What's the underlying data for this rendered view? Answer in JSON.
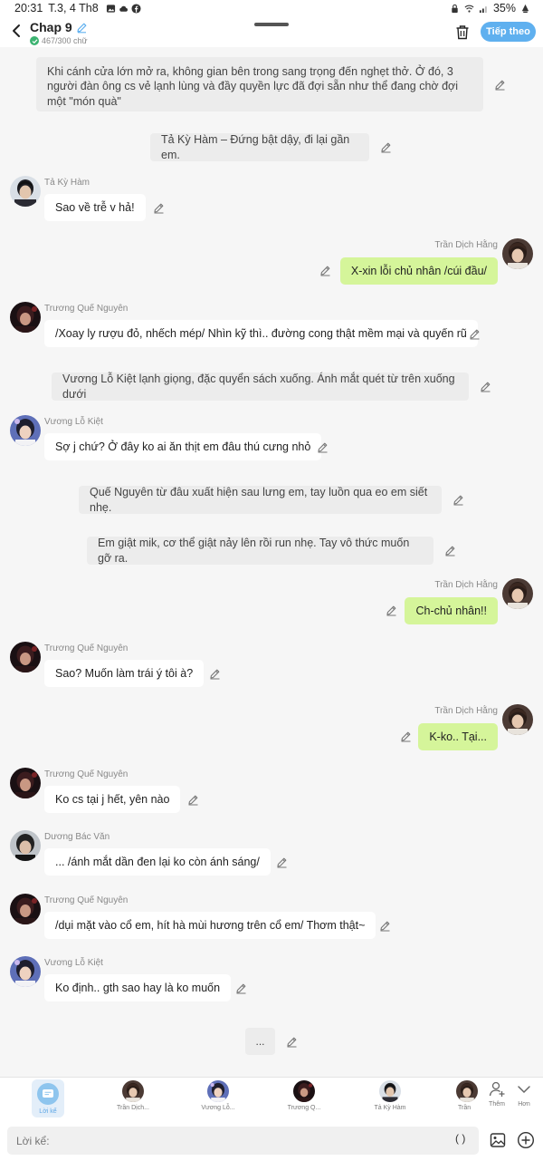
{
  "status_bar": {
    "time": "20:31",
    "date": "T.3, 4 Th8",
    "battery": "35%"
  },
  "header": {
    "title": "Chap 9",
    "word_count": "467/300 chữ",
    "next_label": "Tiếp theo"
  },
  "narrations": [
    "Khi cánh cửa lớn mở ra, không gian bên trong sang trọng đến nghẹt thở. Ở đó, 3 người đàn ông cs vẻ lạnh lùng và đầy quyền lực đã đợi sẵn như thể đang chờ đợi một \"món quà\"",
    "Tả Kỳ Hàm – Đứng bật dậy, đi lại gần em.",
    "Vương Lỗ Kiệt lạnh giọng, đặc quyển sách xuống. Ánh mắt quét từ trên xuống dưới",
    "Quế Nguyên từ đâu xuất hiện sau lưng em, tay luồn qua eo em siết nhẹ.",
    "Em giật mik, cơ thể giật nảy lên rồi run nhẹ. Tay vô thức muốn gỡ ra."
  ],
  "messages": [
    {
      "sender": "Tả Kỳ Hàm",
      "text": "Sao về trễ v hả!"
    },
    {
      "sender": "Trần Dịch Hằng",
      "text": "X-xin lỗi chủ nhân /cúi đầu/"
    },
    {
      "sender": "Trương Quế Nguyên",
      "text": "/Xoay ly rượu đỏ, nhếch mép/ Nhìn kỹ thì.. đường cong thật mềm mại và quyến rũ"
    },
    {
      "sender": "Vương Lỗ Kiệt",
      "text": "Sợ j chứ? Ở đây ko ai ăn thịt em đâu thú cưng nhỏ"
    },
    {
      "sender": "Trần Dịch Hằng",
      "text": "Ch-chủ nhân!!"
    },
    {
      "sender": "Trương Quế Nguyên",
      "text": "Sao? Muốn làm trái ý tôi à?"
    },
    {
      "sender": "Trần Dịch Hằng",
      "text": "K-ko.. Tại..."
    },
    {
      "sender": "Trương Quế Nguyên",
      "text": "Ko cs tại j hết, yên nào"
    },
    {
      "sender": "Dương Bác Văn",
      "text": "... /ánh mắt dần đen lại ko còn ánh sáng/"
    },
    {
      "sender": "Trương Quế Nguyên",
      "text": "/dụi mặt vào cổ em, hít hà mùi hương trên cổ em/ Thơm thật~"
    },
    {
      "sender": "Vương Lỗ Kiệt",
      "text": "Ko định.. gth sao hay là ko muốn"
    }
  ],
  "pending": "...",
  "character_bar": {
    "narrator_label": "Lời kể",
    "characters": [
      "Trần Dịch...",
      "Vương Lỗ...",
      "Trương Q...",
      "Tả Kỳ Hàm",
      "Trần"
    ],
    "add_label": "Thêm",
    "more_label": "Hơn"
  },
  "input": {
    "placeholder": "Lời kể:",
    "paren_label": "( )"
  },
  "colors": {
    "accent": "#5fb0ef",
    "player_bubble": "#d5f59a",
    "narration_bg": "#ececec"
  }
}
